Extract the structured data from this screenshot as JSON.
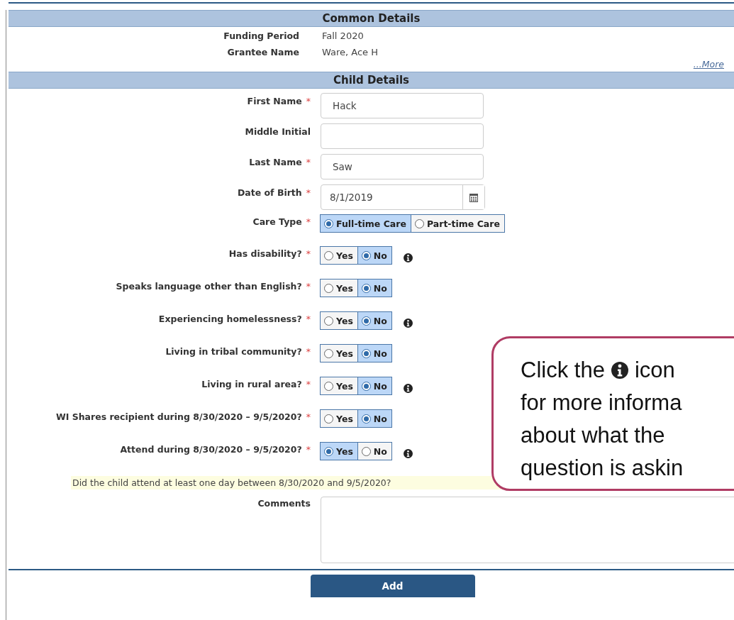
{
  "common_details": {
    "title": "Common Details",
    "rows": [
      {
        "label": "Funding Period",
        "value": "Fall 2020"
      },
      {
        "label": "Grantee Name",
        "value": "Ware, Ace H"
      }
    ],
    "more_link": "...More"
  },
  "child_details": {
    "title": "Child Details",
    "fields": [
      {
        "kind": "text",
        "label": "First Name",
        "required_mark": "*",
        "value": "Hack"
      },
      {
        "kind": "text",
        "label": "Middle Initial"
      },
      {
        "kind": "text",
        "label": "Last Name",
        "required_mark": "*",
        "value": "Saw"
      },
      {
        "kind": "date",
        "label": "Date of Birth",
        "required_mark": "*",
        "value": "8/1/2019"
      },
      {
        "kind": "radio",
        "label": "Care Type",
        "required_mark": "*",
        "info": false,
        "options": [
          {
            "label": "Full-time Care",
            "selected": true
          },
          {
            "label": "Part-time Care",
            "selected": false
          }
        ]
      },
      {
        "kind": "radio",
        "label": "Has disability?",
        "required_mark": "*",
        "info": true,
        "options": [
          {
            "label": "Yes",
            "selected": false
          },
          {
            "label": "No",
            "selected": true
          }
        ]
      },
      {
        "kind": "radio",
        "label": "Speaks language other than English?",
        "required_mark": "*",
        "info": false,
        "options": [
          {
            "label": "Yes",
            "selected": false
          },
          {
            "label": "No",
            "selected": true
          }
        ]
      },
      {
        "kind": "radio",
        "label": "Experiencing homelessness?",
        "required_mark": "*",
        "info": true,
        "options": [
          {
            "label": "Yes",
            "selected": false
          },
          {
            "label": "No",
            "selected": true
          }
        ]
      },
      {
        "kind": "radio",
        "label": "Living in tribal community?",
        "required_mark": "*",
        "info": false,
        "options": [
          {
            "label": "Yes",
            "selected": false
          },
          {
            "label": "No",
            "selected": true
          }
        ]
      },
      {
        "kind": "radio",
        "label": "Living in rural area?",
        "required_mark": "*",
        "info": true,
        "options": [
          {
            "label": "Yes",
            "selected": false
          },
          {
            "label": "No",
            "selected": true
          }
        ]
      },
      {
        "kind": "radio",
        "label": "WI Shares recipient during 8/30/2020 – 9/5/2020?",
        "required_mark": "*",
        "info": false,
        "options": [
          {
            "label": "Yes",
            "selected": false
          },
          {
            "label": "No",
            "selected": true
          }
        ]
      },
      {
        "kind": "radio",
        "label": "Attend during 8/30/2020 – 9/5/2020?",
        "required_mark": "*",
        "info": true,
        "options": [
          {
            "label": "Yes",
            "selected": true
          },
          {
            "label": "No",
            "selected": false
          }
        ]
      },
      {
        "kind": "hint",
        "text": "Did the child attend at least one day between 8/30/2020 and 9/5/2020?"
      },
      {
        "kind": "textarea",
        "label": "Comments"
      }
    ]
  },
  "add_button": "Add",
  "callout": {
    "lines": [
      "Click the",
      "icon",
      "for more informa",
      "about what the",
      "question is askin"
    ]
  }
}
